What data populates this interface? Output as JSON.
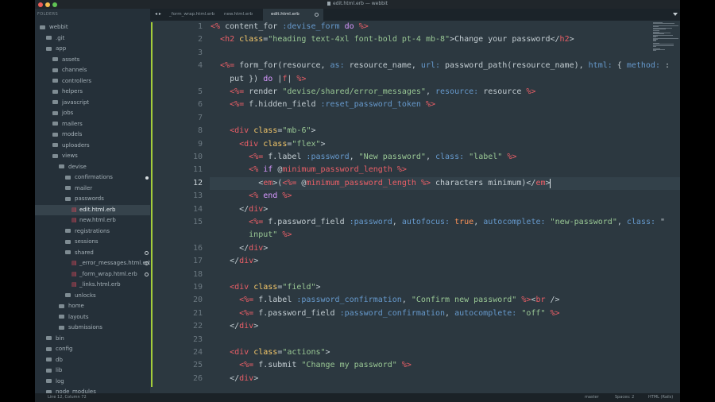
{
  "window": {
    "title": "edit.html.erb — webbit"
  },
  "sidebar": {
    "header": "FOLDERS",
    "items": [
      {
        "label": "webbit",
        "indent": 0,
        "kind": "folder"
      },
      {
        "label": ".git",
        "indent": 1,
        "kind": "folder"
      },
      {
        "label": "app",
        "indent": 1,
        "kind": "folder"
      },
      {
        "label": "assets",
        "indent": 2,
        "kind": "folder"
      },
      {
        "label": "channels",
        "indent": 2,
        "kind": "folder"
      },
      {
        "label": "controllers",
        "indent": 2,
        "kind": "folder"
      },
      {
        "label": "helpers",
        "indent": 2,
        "kind": "folder"
      },
      {
        "label": "javascript",
        "indent": 2,
        "kind": "folder"
      },
      {
        "label": "jobs",
        "indent": 2,
        "kind": "folder"
      },
      {
        "label": "mailers",
        "indent": 2,
        "kind": "folder"
      },
      {
        "label": "models",
        "indent": 2,
        "kind": "folder"
      },
      {
        "label": "uploaders",
        "indent": 2,
        "kind": "folder"
      },
      {
        "label": "views",
        "indent": 2,
        "kind": "folder"
      },
      {
        "label": "devise",
        "indent": 3,
        "kind": "folder"
      },
      {
        "label": "confirmations",
        "indent": 4,
        "kind": "folder",
        "marker": "dot"
      },
      {
        "label": "mailer",
        "indent": 4,
        "kind": "folder"
      },
      {
        "label": "passwords",
        "indent": 4,
        "kind": "folder"
      },
      {
        "label": "edit.html.erb",
        "indent": 5,
        "kind": "erb",
        "selected": true
      },
      {
        "label": "new.html.erb",
        "indent": 5,
        "kind": "erb"
      },
      {
        "label": "registrations",
        "indent": 4,
        "kind": "folder"
      },
      {
        "label": "sessions",
        "indent": 4,
        "kind": "folder"
      },
      {
        "label": "shared",
        "indent": 4,
        "kind": "folder",
        "marker": "ring"
      },
      {
        "label": "_error_messages.html.erb",
        "indent": 5,
        "kind": "erb",
        "marker": "ring"
      },
      {
        "label": "_form_wrap.html.erb",
        "indent": 5,
        "kind": "erb",
        "marker": "ring"
      },
      {
        "label": "_links.html.erb",
        "indent": 5,
        "kind": "erb"
      },
      {
        "label": "unlocks",
        "indent": 4,
        "kind": "folder"
      },
      {
        "label": "home",
        "indent": 3,
        "kind": "folder"
      },
      {
        "label": "layouts",
        "indent": 3,
        "kind": "folder"
      },
      {
        "label": "submissions",
        "indent": 3,
        "kind": "folder"
      },
      {
        "label": "bin",
        "indent": 1,
        "kind": "folder"
      },
      {
        "label": "config",
        "indent": 1,
        "kind": "folder"
      },
      {
        "label": "db",
        "indent": 1,
        "kind": "folder"
      },
      {
        "label": "lib",
        "indent": 1,
        "kind": "folder"
      },
      {
        "label": "log",
        "indent": 1,
        "kind": "folder"
      },
      {
        "label": "node_modules",
        "indent": 1,
        "kind": "folder"
      }
    ]
  },
  "tabs": [
    {
      "label": "_form_wrap.html.erb",
      "active": false
    },
    {
      "label": "new.html.erb",
      "active": false
    },
    {
      "label": "edit.html.erb",
      "active": true
    }
  ],
  "editor": {
    "current_line": 12,
    "modified_lines": [
      1,
      2,
      3,
      4,
      5,
      6,
      7,
      8,
      9,
      10,
      11,
      12,
      13,
      14,
      15,
      16,
      17,
      18,
      19,
      20,
      21,
      22,
      23,
      24,
      25,
      26
    ],
    "lines": [
      {
        "n": "1",
        "tokens": [
          [
            "tag",
            "<%"
          ],
          [
            "txt",
            " content_for "
          ],
          [
            "sym",
            ":devise_form"
          ],
          [
            "txt",
            " "
          ],
          [
            "kw",
            "do"
          ],
          [
            "txt",
            " "
          ],
          [
            "tag",
            "%>"
          ]
        ]
      },
      {
        "n": "2",
        "tokens": [
          [
            "txt",
            "  "
          ],
          [
            "tag",
            "<h2"
          ],
          [
            "txt",
            " "
          ],
          [
            "attr",
            "class"
          ],
          [
            "txt",
            "="
          ],
          [
            "str",
            "\"heading text-4xl font-bold pt-4 mb-8\""
          ],
          [
            "txt",
            ">Change your password</"
          ],
          [
            "tag",
            "h2"
          ],
          [
            "txt",
            ">"
          ]
        ]
      },
      {
        "n": "3",
        "tokens": []
      },
      {
        "n": "4",
        "tokens": [
          [
            "txt",
            "  "
          ],
          [
            "tag",
            "<%="
          ],
          [
            "txt",
            " form_for(resource, "
          ],
          [
            "sym",
            "as:"
          ],
          [
            "txt",
            " resource_name, "
          ],
          [
            "sym",
            "url:"
          ],
          [
            "txt",
            " password_path(resource_name), "
          ],
          [
            "sym",
            "html:"
          ],
          [
            "txt",
            " { "
          ],
          [
            "sym",
            "method:"
          ],
          [
            "txt",
            " :"
          ]
        ]
      },
      {
        "n": "",
        "tokens": [
          [
            "txt",
            "    put }) "
          ],
          [
            "kw",
            "do"
          ],
          [
            "txt",
            " |"
          ],
          [
            "iv",
            "f"
          ],
          [
            "txt",
            "| "
          ],
          [
            "tag",
            "%>"
          ]
        ]
      },
      {
        "n": "5",
        "tokens": [
          [
            "txt",
            "    "
          ],
          [
            "tag",
            "<%="
          ],
          [
            "txt",
            " render "
          ],
          [
            "str",
            "\"devise/shared/error_messages\""
          ],
          [
            "txt",
            ", "
          ],
          [
            "sym",
            "resource:"
          ],
          [
            "txt",
            " resource "
          ],
          [
            "tag",
            "%>"
          ]
        ]
      },
      {
        "n": "6",
        "tokens": [
          [
            "txt",
            "    "
          ],
          [
            "tag",
            "<%="
          ],
          [
            "txt",
            " f.hidden_field "
          ],
          [
            "sym",
            ":reset_password_token"
          ],
          [
            "txt",
            " "
          ],
          [
            "tag",
            "%>"
          ]
        ]
      },
      {
        "n": "7",
        "tokens": []
      },
      {
        "n": "8",
        "tokens": [
          [
            "txt",
            "    "
          ],
          [
            "tag",
            "<div"
          ],
          [
            "txt",
            " "
          ],
          [
            "attr",
            "class"
          ],
          [
            "txt",
            "="
          ],
          [
            "str",
            "\"mb-6\""
          ],
          [
            "txt",
            ">"
          ]
        ]
      },
      {
        "n": "9",
        "tokens": [
          [
            "txt",
            "      "
          ],
          [
            "tag",
            "<div"
          ],
          [
            "txt",
            " "
          ],
          [
            "attr",
            "class"
          ],
          [
            "txt",
            "="
          ],
          [
            "str",
            "\"flex\""
          ],
          [
            "txt",
            ">"
          ]
        ]
      },
      {
        "n": "10",
        "tokens": [
          [
            "txt",
            "        "
          ],
          [
            "tag",
            "<%="
          ],
          [
            "txt",
            " f.label "
          ],
          [
            "sym",
            ":password"
          ],
          [
            "txt",
            ", "
          ],
          [
            "str",
            "\"New password\""
          ],
          [
            "txt",
            ", "
          ],
          [
            "sym",
            "class:"
          ],
          [
            "txt",
            " "
          ],
          [
            "str",
            "\"label\""
          ],
          [
            "txt",
            " "
          ],
          [
            "tag",
            "%>"
          ]
        ]
      },
      {
        "n": "11",
        "tokens": [
          [
            "txt",
            "        "
          ],
          [
            "tag",
            "<%"
          ],
          [
            "txt",
            " "
          ],
          [
            "kw",
            "if"
          ],
          [
            "txt",
            " @"
          ],
          [
            "iv",
            "minimum_password_length"
          ],
          [
            "txt",
            " "
          ],
          [
            "tag",
            "%>"
          ]
        ]
      },
      {
        "n": "12",
        "tokens": [
          [
            "txt",
            "          <"
          ],
          [
            "tag",
            "em"
          ],
          [
            "txt",
            ">("
          ],
          [
            "tag",
            "<%="
          ],
          [
            "txt",
            " @"
          ],
          [
            "iv",
            "minimum_password_length"
          ],
          [
            "txt",
            " "
          ],
          [
            "tag",
            "%>"
          ],
          [
            "txt",
            " characters minimum)</"
          ],
          [
            "tag",
            "em"
          ],
          [
            "txt",
            ">"
          ]
        ]
      },
      {
        "n": "13",
        "tokens": [
          [
            "txt",
            "        "
          ],
          [
            "tag",
            "<%"
          ],
          [
            "txt",
            " "
          ],
          [
            "kw",
            "end"
          ],
          [
            "txt",
            " "
          ],
          [
            "tag",
            "%>"
          ]
        ]
      },
      {
        "n": "14",
        "tokens": [
          [
            "txt",
            "      </"
          ],
          [
            "tag",
            "div"
          ],
          [
            "txt",
            ">"
          ]
        ]
      },
      {
        "n": "15",
        "tokens": [
          [
            "txt",
            "        "
          ],
          [
            "tag",
            "<%="
          ],
          [
            "txt",
            " f.password_field "
          ],
          [
            "sym",
            ":password"
          ],
          [
            "txt",
            ", "
          ],
          [
            "sym",
            "autofocus:"
          ],
          [
            "txt",
            " "
          ],
          [
            "bool",
            "true"
          ],
          [
            "txt",
            ", "
          ],
          [
            "sym",
            "autocomplete:"
          ],
          [
            "txt",
            " "
          ],
          [
            "str",
            "\"new-password\""
          ],
          [
            "txt",
            ", "
          ],
          [
            "sym",
            "class:"
          ],
          [
            "txt",
            " \""
          ]
        ]
      },
      {
        "n": "",
        "tokens": [
          [
            "str",
            "        input\""
          ],
          [
            "txt",
            " "
          ],
          [
            "tag",
            "%>"
          ]
        ]
      },
      {
        "n": "16",
        "tokens": [
          [
            "txt",
            "      </"
          ],
          [
            "tag",
            "div"
          ],
          [
            "txt",
            ">"
          ]
        ]
      },
      {
        "n": "17",
        "tokens": [
          [
            "txt",
            "    </"
          ],
          [
            "tag",
            "div"
          ],
          [
            "txt",
            ">"
          ]
        ]
      },
      {
        "n": "18",
        "tokens": []
      },
      {
        "n": "19",
        "tokens": [
          [
            "txt",
            "    "
          ],
          [
            "tag",
            "<div"
          ],
          [
            "txt",
            " "
          ],
          [
            "attr",
            "class"
          ],
          [
            "txt",
            "="
          ],
          [
            "str",
            "\"field\""
          ],
          [
            "txt",
            ">"
          ]
        ]
      },
      {
        "n": "20",
        "tokens": [
          [
            "txt",
            "      "
          ],
          [
            "tag",
            "<%="
          ],
          [
            "txt",
            " f.label "
          ],
          [
            "sym",
            ":password_confirmation"
          ],
          [
            "txt",
            ", "
          ],
          [
            "str",
            "\"Confirm new password\""
          ],
          [
            "txt",
            " "
          ],
          [
            "tag",
            "%>"
          ],
          [
            "txt",
            "<"
          ],
          [
            "tag",
            "br"
          ],
          [
            "txt",
            " />"
          ]
        ]
      },
      {
        "n": "21",
        "tokens": [
          [
            "txt",
            "      "
          ],
          [
            "tag",
            "<%="
          ],
          [
            "txt",
            " f.password_field "
          ],
          [
            "sym",
            ":password_confirmation"
          ],
          [
            "txt",
            ", "
          ],
          [
            "sym",
            "autocomplete:"
          ],
          [
            "txt",
            " "
          ],
          [
            "str",
            "\"off\""
          ],
          [
            "txt",
            " "
          ],
          [
            "tag",
            "%>"
          ]
        ]
      },
      {
        "n": "22",
        "tokens": [
          [
            "txt",
            "    </"
          ],
          [
            "tag",
            "div"
          ],
          [
            "txt",
            ">"
          ]
        ]
      },
      {
        "n": "23",
        "tokens": []
      },
      {
        "n": "24",
        "tokens": [
          [
            "txt",
            "    "
          ],
          [
            "tag",
            "<div"
          ],
          [
            "txt",
            " "
          ],
          [
            "attr",
            "class"
          ],
          [
            "txt",
            "="
          ],
          [
            "str",
            "\"actions\""
          ],
          [
            "txt",
            ">"
          ]
        ]
      },
      {
        "n": "25",
        "tokens": [
          [
            "txt",
            "      "
          ],
          [
            "tag",
            "<%="
          ],
          [
            "txt",
            " f.submit "
          ],
          [
            "str",
            "\"Change my password\""
          ],
          [
            "txt",
            " "
          ],
          [
            "tag",
            "%>"
          ]
        ]
      },
      {
        "n": "26",
        "tokens": [
          [
            "txt",
            "    </"
          ],
          [
            "tag",
            "div"
          ],
          [
            "txt",
            ">"
          ]
        ]
      }
    ]
  },
  "status": {
    "position": "Line 12, Column 72",
    "branch": "master",
    "spaces": "Spaces: 2",
    "syntax": "HTML (Rails)"
  },
  "colors": {
    "sidebar_bg": "#253039",
    "editor_bg": "#2c3840",
    "selected_row": "#36434c",
    "modified_marker": "#a3cc3a",
    "erb_icon": "#d94b5a"
  }
}
